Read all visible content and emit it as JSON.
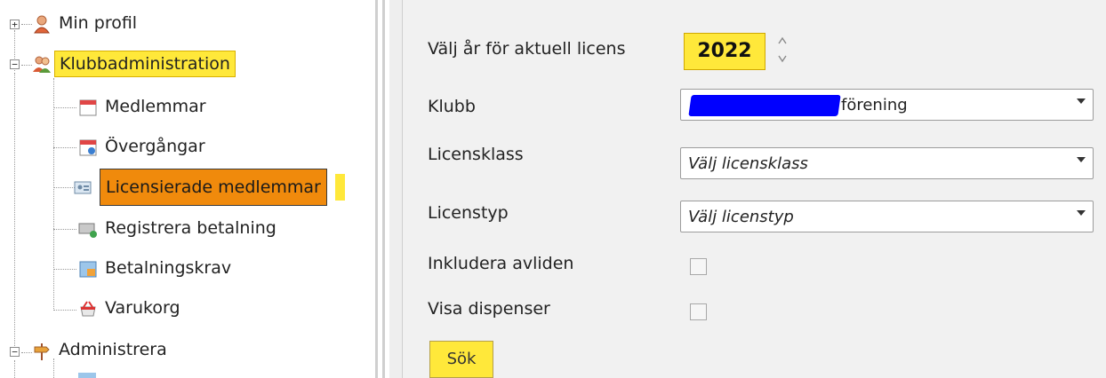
{
  "tree": {
    "items": [
      {
        "label": "Min profil",
        "icon": "user-profile-icon"
      },
      {
        "label": "Klubbadministration",
        "icon": "users-group-icon"
      },
      {
        "label": "Medlemmar",
        "icon": "calendar-icon"
      },
      {
        "label": "Övergångar",
        "icon": "calendar-transfer-icon"
      },
      {
        "label": "Licensierade medlemmar",
        "icon": "license-card-icon"
      },
      {
        "label": "Registrera betalning",
        "icon": "payment-register-icon"
      },
      {
        "label": "Betalningskrav",
        "icon": "payment-request-icon"
      },
      {
        "label": "Varukorg",
        "icon": "shopping-basket-icon"
      },
      {
        "label": "Administrera",
        "icon": "signpost-icon"
      }
    ],
    "expander_collapsed": "+",
    "expander_expanded": "−"
  },
  "form": {
    "year_label": "Välj år för aktuell licens",
    "year_value": "2022",
    "club_label": "Klubb",
    "club_value": "förening",
    "license_class_label": "Licensklass",
    "license_class_value": "Välj licensklass",
    "license_type_label": "Licenstyp",
    "license_type_value": "Välj licenstyp",
    "include_deceased_label": "Inkludera avliden",
    "show_dispensation_label": "Visa dispenser",
    "search_button": "Sök"
  },
  "colors": {
    "highlight_yellow": "#ffe83a",
    "selected_orange": "#f08a0c",
    "redaction_blue": "#0000ff",
    "form_background": "#f1f1f1"
  }
}
